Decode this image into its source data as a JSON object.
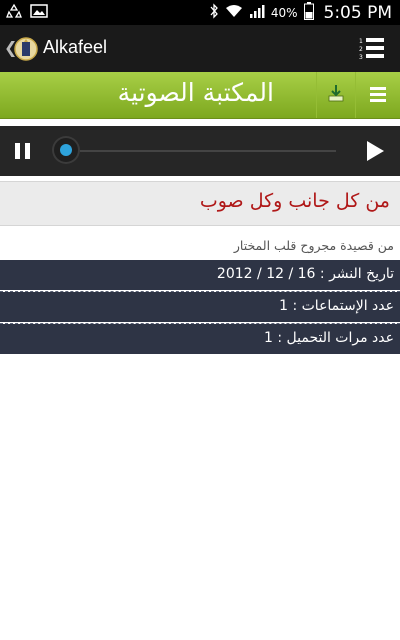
{
  "status_bar": {
    "time": "5:05 PM",
    "battery": "40%",
    "icons": [
      "recycle-icon",
      "image-icon",
      "bluetooth-icon",
      "wifi-icon",
      "signal-icon",
      "battery-icon"
    ]
  },
  "app_bar": {
    "title": "Alkafeel",
    "back_glyph": "❮"
  },
  "green_bar": {
    "title": "المكتبة الصوتية",
    "color": "#8fbe2e"
  },
  "player": {
    "state": "paused",
    "progress": 0,
    "accent": "#2ea3dc"
  },
  "content": {
    "title": "من كل جانب وكل صوب",
    "subtitle": "من قصيدة مجروح قلب المختار",
    "title_color": "#b01818",
    "info": [
      "تاريخ النشر : 16 / 12 / 2012",
      "عدد الإستماعات : 1",
      "عدد مرات التحميل : 1"
    ]
  }
}
